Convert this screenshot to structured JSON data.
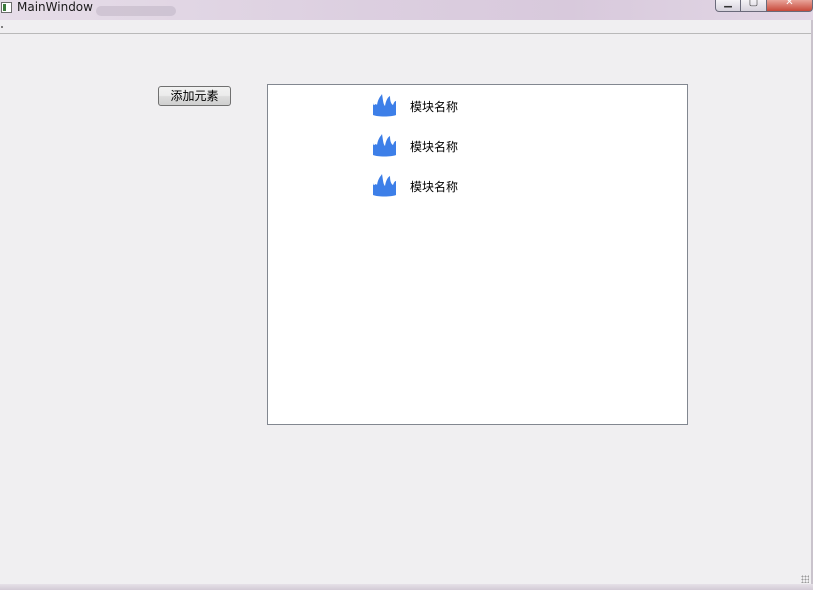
{
  "window": {
    "title": "MainWindow"
  },
  "caption_buttons": {
    "minimize_icon": "minimize-icon",
    "maximize_icon": "maximize-icon",
    "close_icon": "close-icon"
  },
  "toolbar": {
    "add_label": "添加元素"
  },
  "list": {
    "items": [
      {
        "label": "模块名称",
        "icon": "module-icon"
      },
      {
        "label": "模块名称",
        "icon": "module-icon"
      },
      {
        "label": "模块名称",
        "icon": "module-icon"
      }
    ]
  },
  "colors": {
    "icon_blue": "#3d7fe8",
    "list_background": "#ffffff",
    "window_background": "#f0eff1"
  }
}
